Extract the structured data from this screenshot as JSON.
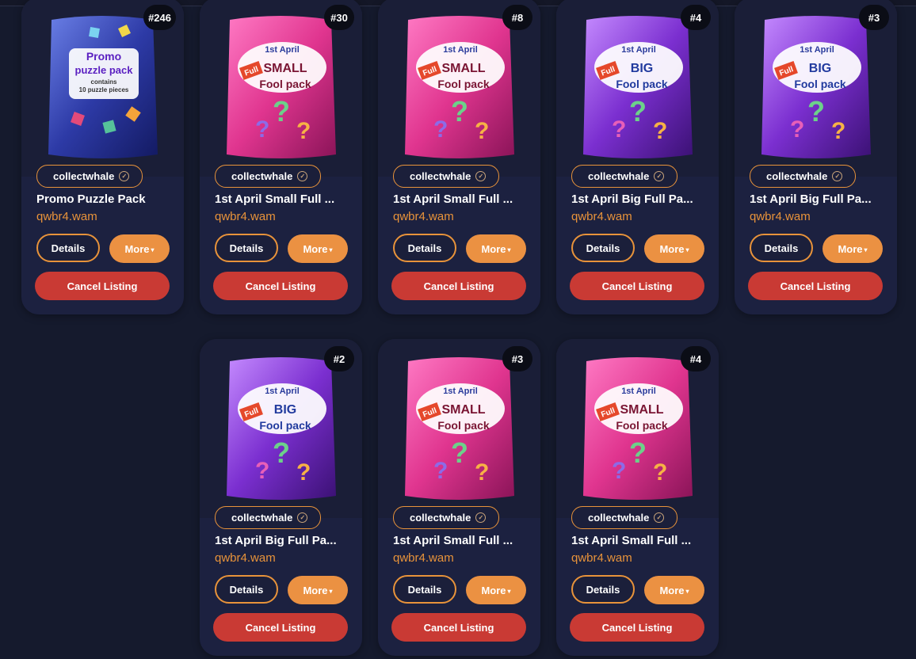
{
  "common": {
    "details_label": "Details",
    "more_label": "More",
    "cancel_label": "Cancel Listing",
    "collection": "collectwhale",
    "owner": "qwbr4.wam"
  },
  "cards": [
    {
      "mint": "#246",
      "title": "Promo Puzzle Pack",
      "pack_lines": [
        "Promo",
        "puzzle pack"
      ],
      "pack_sub": [
        "contains",
        "10 puzzle pieces"
      ]
    },
    {
      "mint": "#30",
      "title": "1st April Small Full ...",
      "pack_top": "1st April",
      "pack_main": "SMALL",
      "pack_tag": "Full",
      "pack_bottom": "Fool pack"
    },
    {
      "mint": "#8",
      "title": "1st April Small Full ...",
      "pack_top": "1st April",
      "pack_main": "SMALL",
      "pack_tag": "Full",
      "pack_bottom": "Fool pack"
    },
    {
      "mint": "#4",
      "title": "1st April Big Full Pa...",
      "pack_top": "1st April",
      "pack_main": "BIG",
      "pack_tag": "Full",
      "pack_bottom": "Fool pack"
    },
    {
      "mint": "#3",
      "title": "1st April Big Full Pa...",
      "pack_top": "1st April",
      "pack_main": "BIG",
      "pack_tag": "Full",
      "pack_bottom": "Fool pack"
    },
    {
      "mint": "#2",
      "title": "1st April Big Full Pa...",
      "pack_top": "1st April",
      "pack_main": "BIG",
      "pack_tag": "Full",
      "pack_bottom": "Fool pack"
    },
    {
      "mint": "#3",
      "title": "1st April Small Full ...",
      "pack_top": "1st April",
      "pack_main": "SMALL",
      "pack_tag": "Full",
      "pack_bottom": "Fool pack"
    },
    {
      "mint": "#4",
      "title": "1st April Small Full ...",
      "pack_top": "1st April",
      "pack_main": "SMALL",
      "pack_tag": "Full",
      "pack_bottom": "Fool pack"
    }
  ],
  "colors": {
    "background": "#151a2d",
    "card": "#1c2140",
    "accent": "#e8933a",
    "cancel": "#c93a34",
    "small_pack": "#e0358f",
    "big_pack": "#7b2fd0",
    "promo_pack": "#4b57c8"
  }
}
